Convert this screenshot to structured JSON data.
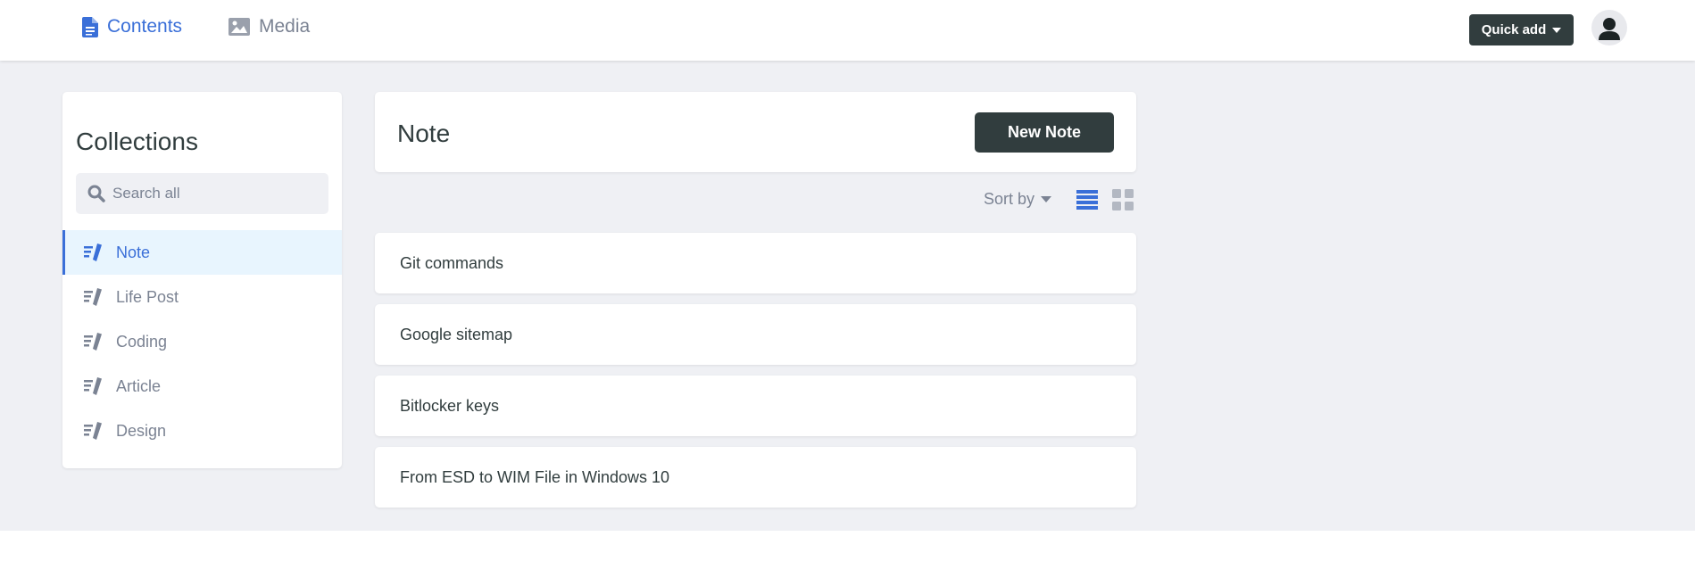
{
  "topbar": {
    "nav": [
      {
        "label": "Contents",
        "icon": "document-icon",
        "active": true
      },
      {
        "label": "Media",
        "icon": "image-icon",
        "active": false
      }
    ],
    "quick_add_label": "Quick add"
  },
  "sidebar": {
    "title": "Collections",
    "search_placeholder": "Search all",
    "items": [
      {
        "label": "Note",
        "active": true
      },
      {
        "label": "Life Post",
        "active": false
      },
      {
        "label": "Coding",
        "active": false
      },
      {
        "label": "Article",
        "active": false
      },
      {
        "label": "Design",
        "active": false
      }
    ]
  },
  "main": {
    "title": "Note",
    "new_button_label": "New Note",
    "sort_label": "Sort by",
    "entries": [
      "Git commands",
      "Google sitemap",
      "Bitlocker keys",
      "From ESD to WIM File in Windows 10"
    ]
  },
  "colors": {
    "accent": "#3a6fd8",
    "dark_button": "#313d3e",
    "muted_text": "#7b8393",
    "background": "#eff0f4",
    "active_item_bg": "#e8f5fe"
  }
}
